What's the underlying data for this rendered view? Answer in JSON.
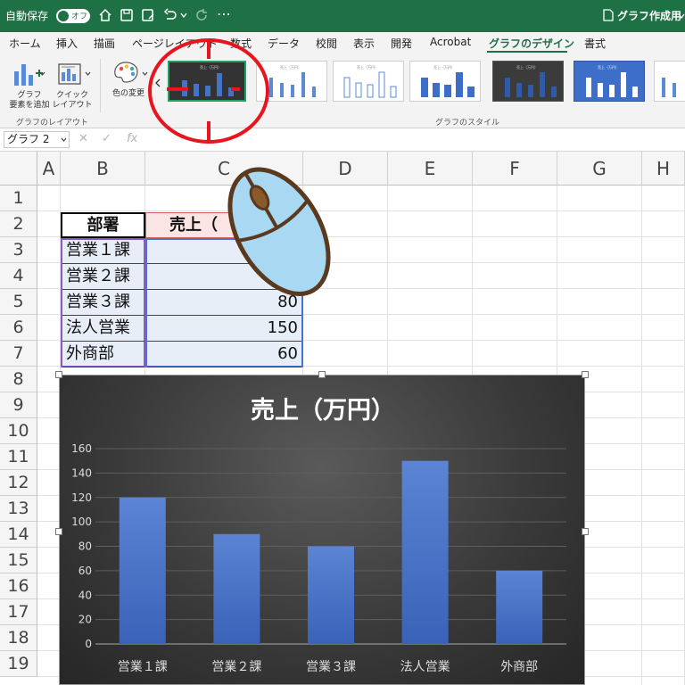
{
  "titlebar": {
    "autosave_label": "自動保存",
    "autosave_state": "オフ",
    "document_title": "グラフ作成用"
  },
  "ribbon_tabs": [
    "ホーム",
    "挿入",
    "描画",
    "ページレイアウト",
    "数式",
    "データ",
    "校閲",
    "表示",
    "開発",
    "Acrobat",
    "グラフのデザイン",
    "書式"
  ],
  "active_tab": "グラフのデザイン",
  "ribbon": {
    "add_element_line1": "グラフ",
    "add_element_line2": "要素を追加",
    "quick_layout_line1": "クイック",
    "quick_layout_line2": "レイアウト",
    "change_color": "色の変更",
    "layout_group": "グラフのレイアウト",
    "styles_group": "グラフのスタイル",
    "thumb_title": "売上（万円）"
  },
  "formula_bar": {
    "name_box": "グラフ 2",
    "fx": "fx"
  },
  "sheet": {
    "columns": [
      "A",
      "B",
      "C",
      "D",
      "E",
      "F",
      "G",
      "H"
    ],
    "rows": [
      "1",
      "2",
      "3",
      "4",
      "5",
      "6",
      "7",
      "8",
      "9",
      "10",
      "11",
      "12",
      "13",
      "14",
      "15",
      "16",
      "17",
      "18",
      "19"
    ],
    "header_dept": "部署",
    "header_sales": "売上（",
    "depts": [
      "営業１課",
      "営業２課",
      "営業３課",
      "法人営業",
      "外商部"
    ],
    "values": [
      "",
      "",
      "80",
      "150",
      "60"
    ]
  },
  "chart_data": {
    "type": "bar",
    "title": "売上（万円）",
    "categories": [
      "営業１課",
      "営業２課",
      "営業３課",
      "法人営業",
      "外商部"
    ],
    "values": [
      120,
      90,
      80,
      150,
      60
    ],
    "ylim": [
      0,
      160
    ],
    "yticks": [
      "0",
      "20",
      "40",
      "60",
      "80",
      "100",
      "120",
      "140",
      "160"
    ],
    "bar_color": "#4472c4",
    "grid": true
  },
  "colors": {
    "excel_green": "#1e7145",
    "highlight_ring": "#e8141e",
    "mouse_fill": "#a9d8f2"
  }
}
